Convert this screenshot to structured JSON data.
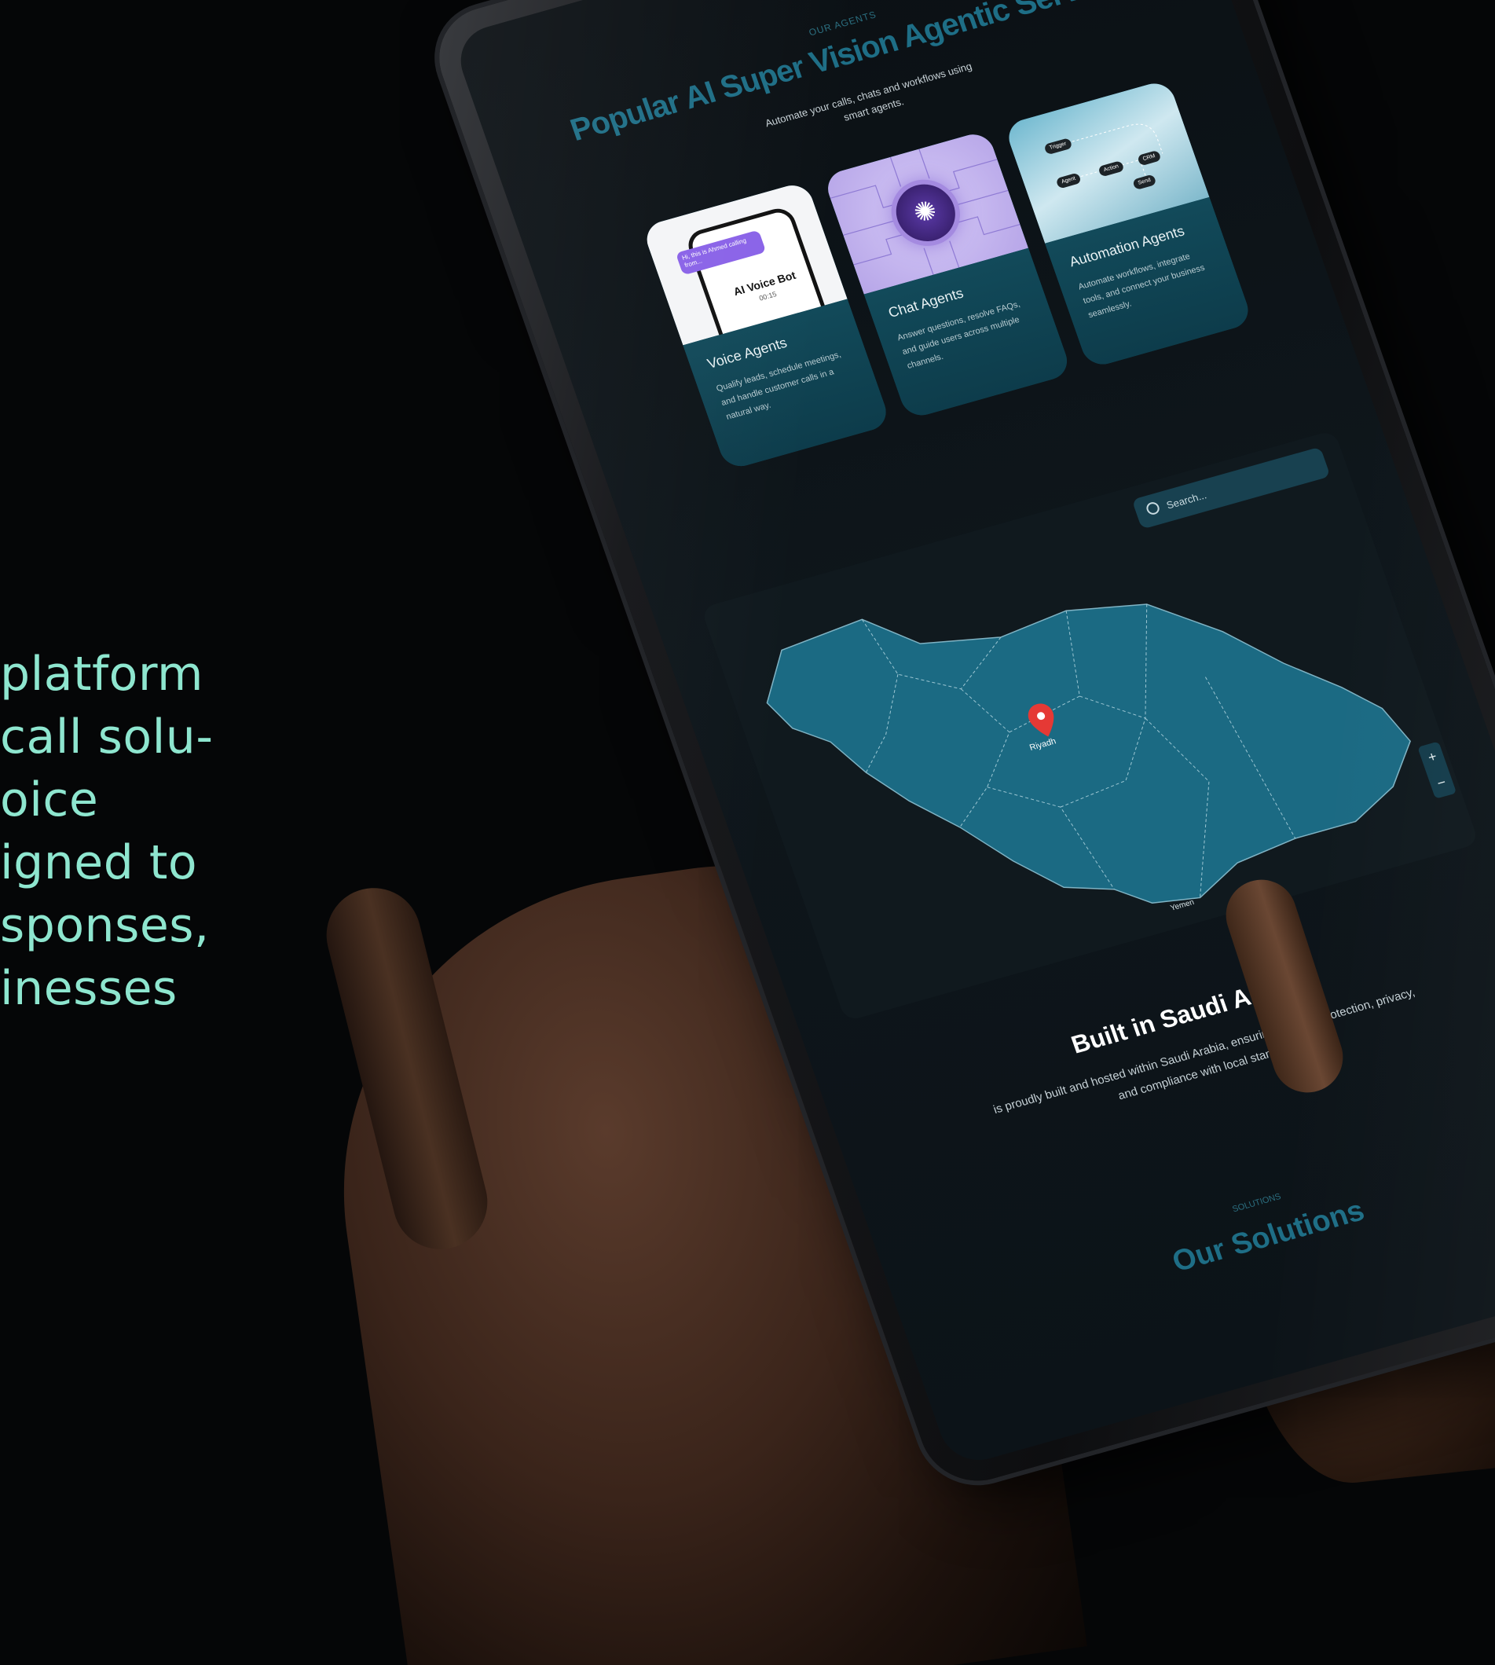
{
  "tagline": {
    "lines": [
      "platform",
      "call solu-",
      "oice",
      "igned to",
      "sponses,",
      "inesses"
    ]
  },
  "section_services": {
    "eyebrow": "OUR AGENTS",
    "title": "Popular AI Super Vision Agentic Services",
    "subtitle_line1": "Automate your calls, chats and workflows using",
    "subtitle_line2": "smart agents.",
    "cards": [
      {
        "title": "Voice Agents",
        "description": "Qualify leads, schedule meetings, and handle customer calls in a natural way.",
        "image_bubble": "Hi, this is Ahmed calling from...",
        "image_title": "AI Voice Bot",
        "image_sub": "00:15"
      },
      {
        "title": "Chat Agents",
        "description": "Answer questions, resolve FAQs, and guide users across multiple channels.",
        "icon": "brain-icon"
      },
      {
        "title": "Automation Agents",
        "description": "Automate workflows, integrate tools, and connect your business seamlessly.",
        "chips": [
          "Trigger",
          "Agent",
          "Action",
          "CRM",
          "Send"
        ]
      }
    ]
  },
  "map": {
    "search_placeholder": "Search...",
    "marker_label": "Riyadh",
    "bottom_label": "Yemen",
    "zoom_in": "+",
    "zoom_out": "−",
    "fill_color": "#1b6a83",
    "marker_color": "#e53935"
  },
  "section_built": {
    "title": "Built in Saudi Arabia",
    "description": "is proudly built and hosted within Saudi Arabia, ensuring full data protection, privacy, and compliance with local standards."
  },
  "section_solutions": {
    "eyebrow": "SOLUTIONS",
    "title": "Our Solutions"
  },
  "colors": {
    "tagline": "#8ee6cf",
    "accent": "#1e6e86",
    "card_body": "#124a5a"
  }
}
